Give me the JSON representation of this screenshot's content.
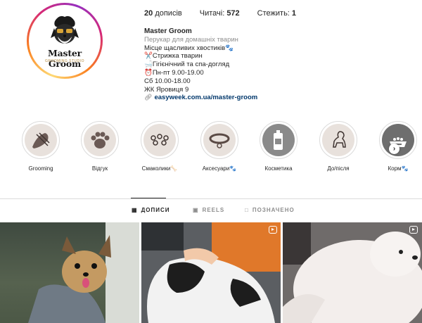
{
  "profile": {
    "brand_name": "Master Groom",
    "brand_subtitle": "GROOMING STUDIO",
    "posts": "20",
    "posts_label": "дописів",
    "followers_label": "Читачі:",
    "followers": "572",
    "following_label": "Стежить:",
    "following": "1"
  },
  "bio": {
    "name": "Master Groom",
    "category": "Перукар для домашніх тварин",
    "lines": [
      "Місце щасливих хвостиків🐾",
      "✂️Стрижка тварин",
      "🛁Гігієнічний та спа-догляд",
      "⏰Пн-пт 9.00-19.00",
      "Сб 10.00-18.00",
      "ЖК Яровиця 9"
    ],
    "link": "easyweek.com.ua/master-groom"
  },
  "highlights": [
    {
      "label": "Grooming",
      "icon": "comb-scissors-icon"
    },
    {
      "label": "Відгук",
      "icon": "paw-icon"
    },
    {
      "label": "Смаколики🦴",
      "icon": "dog-treats-icon"
    },
    {
      "label": "Аксесуари🐾",
      "icon": "dog-collar-icon"
    },
    {
      "label": "Косметика",
      "icon": "shampoo-bottle-icon"
    },
    {
      "label": "До/після",
      "icon": "dog-silhouette-icon"
    },
    {
      "label": "Корм🐾",
      "icon": "food-bowl-icon"
    }
  ],
  "tabs": [
    {
      "label": "ДОПИСИ",
      "icon": "grid-icon",
      "active": true
    },
    {
      "label": "REELS",
      "icon": "reels-icon",
      "active": false
    },
    {
      "label": "ПОЗНАЧЕНО",
      "icon": "tagged-icon",
      "active": false
    }
  ],
  "posts": [
    {
      "subject": "yorkshire-terrier-photo",
      "reel": false
    },
    {
      "subject": "french-bulldog-grooming-photo",
      "reel": true
    },
    {
      "subject": "white-fluffy-dog-photo",
      "reel": true
    }
  ]
}
